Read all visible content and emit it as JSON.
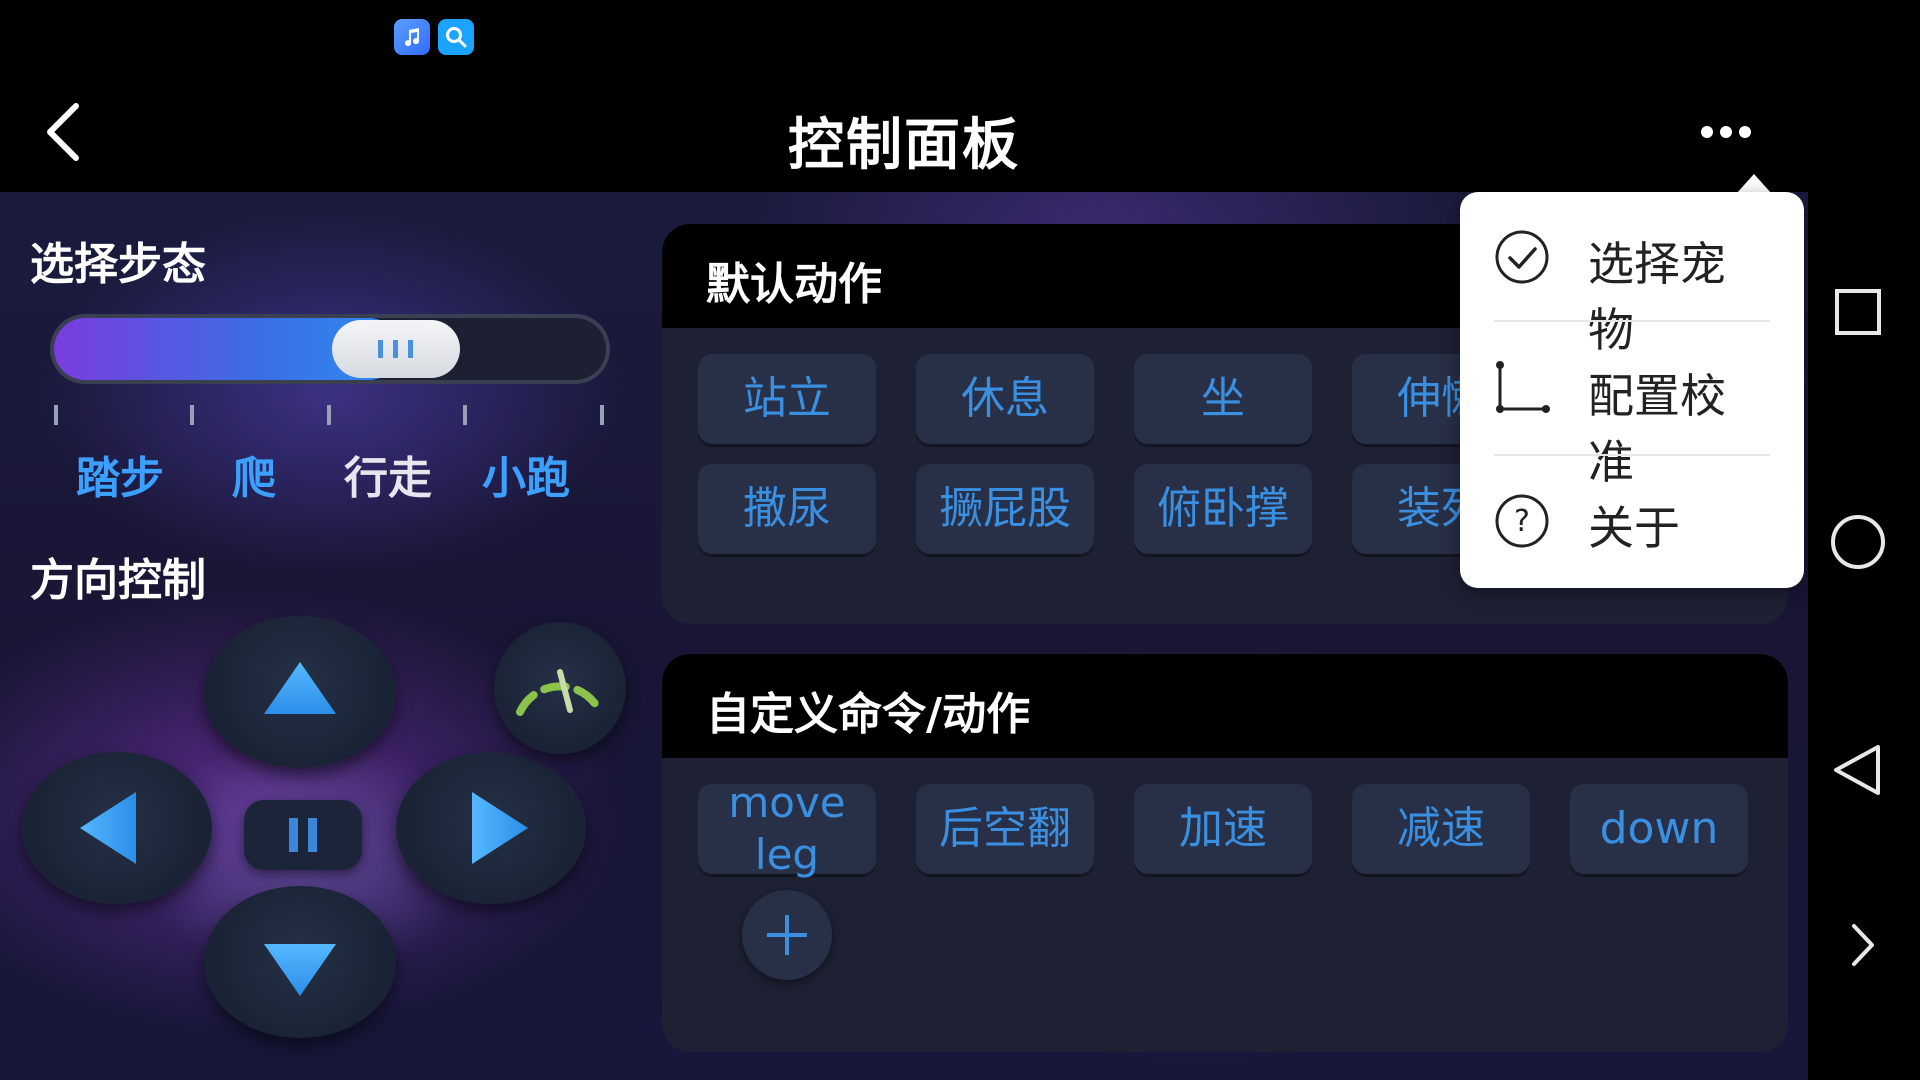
{
  "status_bar": {
    "icons": [
      "music-app-icon",
      "search-app-icon"
    ]
  },
  "header": {
    "title": "控制面板",
    "back_icon": "chevron-left-icon",
    "more_icon": "more-dots-icon"
  },
  "gait": {
    "label": "选择步态",
    "options": [
      "踏步",
      "爬",
      "行走",
      "小跑"
    ],
    "selected": "行走",
    "slider_level": 0.62
  },
  "direction": {
    "label": "方向控制"
  },
  "default_actions": {
    "title": "默认动作",
    "buttons": [
      "站立",
      "休息",
      "坐",
      "伸懒",
      "撒尿",
      "撅屁股",
      "俯卧撑",
      "装死"
    ]
  },
  "custom_actions": {
    "title": "自定义命令/动作",
    "buttons": [
      "move\nleg",
      "后空翻",
      "加速",
      "减速",
      "down"
    ],
    "add_icon": "plus-icon"
  },
  "menu": {
    "items": [
      {
        "label": "选择宠物",
        "icon": "check-circle-icon"
      },
      {
        "label": "配置校准",
        "icon": "calibrate-axis-icon"
      },
      {
        "label": "关于",
        "icon": "help-circle-icon"
      }
    ]
  },
  "nav_bar": {
    "icons": [
      "recents-square-icon",
      "home-circle-icon",
      "back-triangle-icon",
      "expand-chevron-icon"
    ]
  },
  "colors": {
    "accent": "#3a8fe0",
    "panel": "#1e2134",
    "button": "#283047",
    "gauge_green": "#8bc34a"
  }
}
